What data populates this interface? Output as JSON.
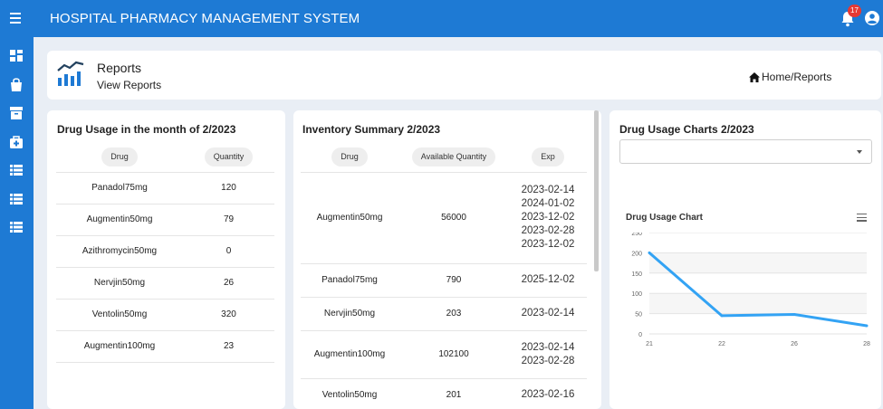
{
  "app": {
    "title": "HOSPITAL PHARMACY MANAGEMENT SYSTEM",
    "notifications": "17"
  },
  "sidebar": {
    "icons": [
      "dashboard-icon",
      "bag-icon",
      "archive-icon",
      "medkit-icon",
      "list-icon",
      "list-icon",
      "list-icon"
    ]
  },
  "header": {
    "title": "Reports",
    "subtitle": "View Reports",
    "breadcrumb": "Home/Reports"
  },
  "usage": {
    "title": "Drug Usage in the month of 2/2023",
    "columns": [
      "Drug",
      "Quantity"
    ],
    "rows": [
      [
        "Panadol75mg",
        "120"
      ],
      [
        "Augmentin50mg",
        "79"
      ],
      [
        "Azithromycin50mg",
        "0"
      ],
      [
        "Nervjin50mg",
        "26"
      ],
      [
        "Ventolin50mg",
        "320"
      ],
      [
        "Augmentin100mg",
        "23"
      ]
    ]
  },
  "inventory": {
    "title": "Inventory Summary 2/2023",
    "columns": [
      "Drug",
      "Available Quantity",
      "Exp"
    ],
    "rows": [
      {
        "drug": "Augmentin50mg",
        "qty": "56000",
        "exp": [
          "2023-02-14",
          "2024-01-02",
          "2023-12-02",
          "2023-02-28",
          "2023-12-02"
        ]
      },
      {
        "drug": "Panadol75mg",
        "qty": "790",
        "exp": [
          "2025-12-02"
        ]
      },
      {
        "drug": "Nervjin50mg",
        "qty": "203",
        "exp": [
          "2023-02-14"
        ]
      },
      {
        "drug": "Augmentin100mg",
        "qty": "102100",
        "exp": [
          "2023-02-14",
          "2023-02-28"
        ]
      },
      {
        "drug": "Ventolin50mg",
        "qty": "201",
        "exp": [
          "2023-02-16"
        ]
      }
    ]
  },
  "charts": {
    "title": "Drug Usage Charts 2/2023",
    "select_value": "",
    "chart_title": "Drug Usage Chart"
  },
  "chart_data": {
    "type": "line",
    "title": "Drug Usage Chart",
    "x": [
      "21",
      "22",
      "26",
      "28"
    ],
    "series": [
      {
        "values": [
          200,
          45,
          48,
          20
        ],
        "color": "#33a3f4"
      }
    ],
    "ylim": [
      0,
      250
    ],
    "yticks": [
      "250",
      "200",
      "150",
      "100",
      "50",
      "0"
    ],
    "grid": true
  }
}
